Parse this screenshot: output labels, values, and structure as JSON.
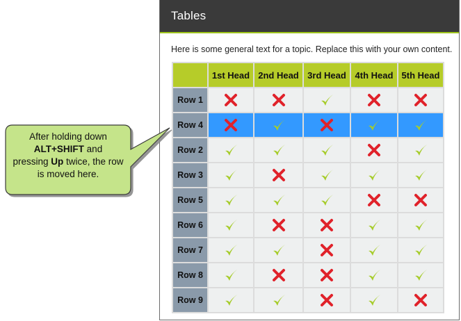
{
  "panel": {
    "title": "Tables",
    "intro": "Here is some general text for a topic. Replace this with your own content."
  },
  "table": {
    "headers": [
      "",
      "1st Head",
      "2nd Head",
      "3rd Head",
      "4th Head",
      "5th Head"
    ],
    "rows": [
      {
        "label": "Row 1",
        "selected": false,
        "cells": [
          "x",
          "x",
          "check",
          "x",
          "x"
        ]
      },
      {
        "label": "Row 4",
        "selected": true,
        "cells": [
          "x",
          "check",
          "x",
          "check",
          "check"
        ]
      },
      {
        "label": "Row 2",
        "selected": false,
        "cells": [
          "check",
          "check",
          "check",
          "x",
          "check"
        ]
      },
      {
        "label": "Row 3",
        "selected": false,
        "cells": [
          "check",
          "x",
          "check",
          "check",
          "check"
        ]
      },
      {
        "label": "Row 5",
        "selected": false,
        "cells": [
          "check",
          "check",
          "check",
          "x",
          "x"
        ]
      },
      {
        "label": "Row 6",
        "selected": false,
        "cells": [
          "check",
          "x",
          "x",
          "check",
          "check"
        ]
      },
      {
        "label": "Row 7",
        "selected": false,
        "cells": [
          "check",
          "check",
          "x",
          "check",
          "check"
        ]
      },
      {
        "label": "Row 8",
        "selected": false,
        "cells": [
          "check",
          "x",
          "x",
          "check",
          "check"
        ]
      },
      {
        "label": "Row 9",
        "selected": false,
        "cells": [
          "check",
          "check",
          "x",
          "check",
          "x"
        ]
      }
    ]
  },
  "callout": {
    "line1": "After holding down",
    "bold1": "ALT+SHIFT",
    "line2": " and",
    "line3": "pressing ",
    "bold2": "Up",
    "line4": " twice, the row is moved here."
  },
  "colors": {
    "header_bar": "#3a3a3a",
    "accent": "#9ec51b",
    "col_header": "#b6cc29",
    "row_header": "#8a9aaa",
    "selected_row": "#3399ff",
    "check": "#a6cc2a",
    "x_mark": "#e0222a",
    "callout_fill": "#c5e48a"
  },
  "icons": {
    "x": "x-icon",
    "check": "check-icon"
  }
}
